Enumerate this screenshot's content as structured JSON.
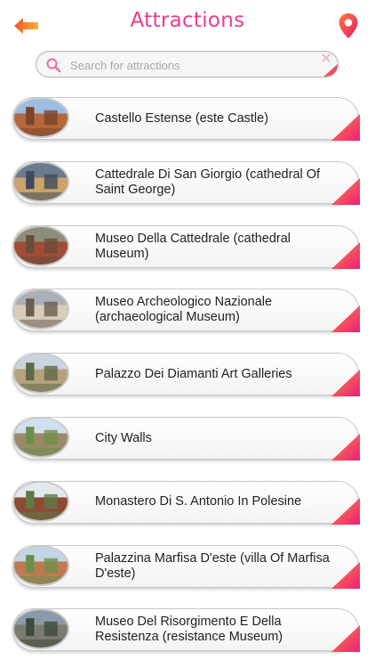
{
  "header": {
    "title": "Attractions",
    "back_icon": "back-arrow-icon",
    "location_icon": "map-pin-icon",
    "accent_color": "#ee3a8c"
  },
  "search": {
    "placeholder": "Search for attractions",
    "value": ""
  },
  "attractions": [
    {
      "label": "Castello Estense (este Castle)"
    },
    {
      "label": "Cattedrale Di San Giorgio (cathedral Of Saint George)"
    },
    {
      "label": "Museo Della Cattedrale (cathedral Museum)"
    },
    {
      "label": "Museo Archeologico Nazionale (archaeological Museum)"
    },
    {
      "label": "Palazzo Dei Diamanti Art Galleries"
    },
    {
      "label": "City Walls"
    },
    {
      "label": "Monastero Di S. Antonio In Polesine"
    },
    {
      "label": "Palazzina Marfisa D'este (villa Of Marfisa D'este)"
    },
    {
      "label": "Museo Del Risorgimento E Della Resistenza (resistance Museum)"
    }
  ]
}
